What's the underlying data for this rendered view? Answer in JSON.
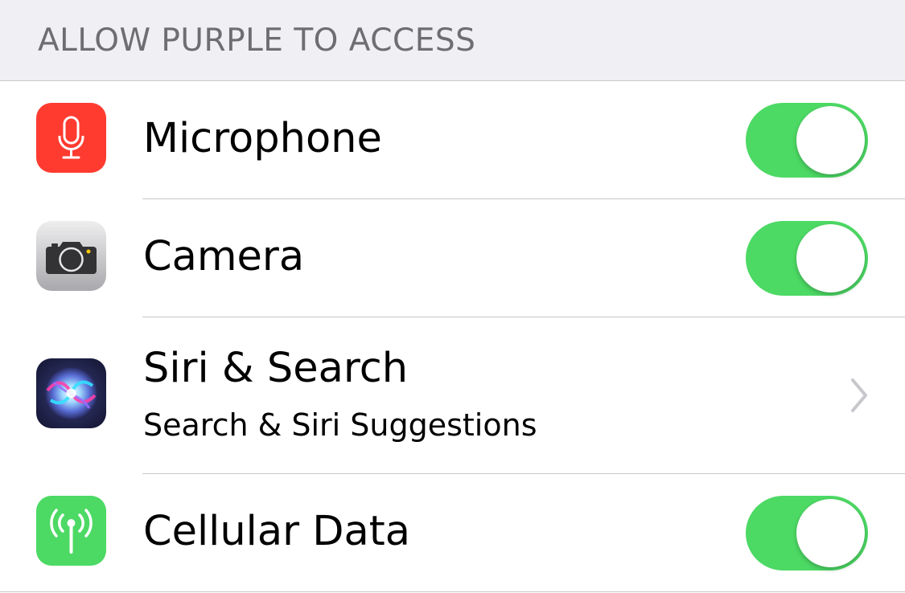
{
  "section": {
    "header": "ALLOW PURPLE TO ACCESS"
  },
  "rows": [
    {
      "title": "Microphone",
      "icon": "microphone-icon",
      "icon_color": "#ff3b30",
      "control": "toggle",
      "on": true
    },
    {
      "title": "Camera",
      "icon": "camera-icon",
      "icon_color": "#8e8e93",
      "control": "toggle",
      "on": true
    },
    {
      "title": "Siri & Search",
      "subtitle": "Search & Siri Suggestions",
      "icon": "siri-icon",
      "icon_color": "#1c1c3a",
      "control": "chevron"
    },
    {
      "title": "Cellular Data",
      "icon": "cellular-antenna-icon",
      "icon_color": "#4cd964",
      "control": "toggle",
      "on": true
    }
  ],
  "colors": {
    "toggle_on": "#4cd964",
    "header_bg": "#efeff4",
    "header_text": "#6d6d72",
    "separator": "#c8c7cc",
    "chevron": "#c7c7cc"
  }
}
